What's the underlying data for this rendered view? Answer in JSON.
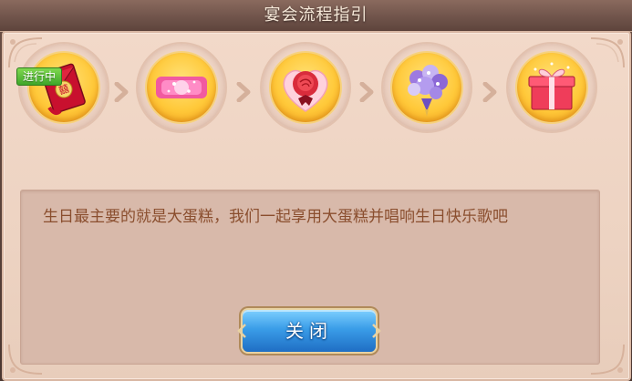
{
  "dialog": {
    "title": "宴会流程指引",
    "status_badge": "进行中",
    "description": "生日最主要的就是大蛋糕，我们一起享用大蛋糕并唱响生日快乐歌吧",
    "close_label": "关闭"
  },
  "steps": [
    {
      "icon": "red-envelope-icon",
      "status": "active"
    },
    {
      "icon": "pink-ribbon-icon",
      "status": "pending"
    },
    {
      "icon": "rose-heart-icon",
      "status": "pending"
    },
    {
      "icon": "flower-bouquet-icon",
      "status": "pending"
    },
    {
      "icon": "gift-box-icon",
      "status": "pending"
    }
  ],
  "colors": {
    "panel_bg": "#f2d9c9",
    "description_text": "#8a4e2e",
    "button_blue": "#3a9de8",
    "badge_green": "#3fa62a"
  }
}
